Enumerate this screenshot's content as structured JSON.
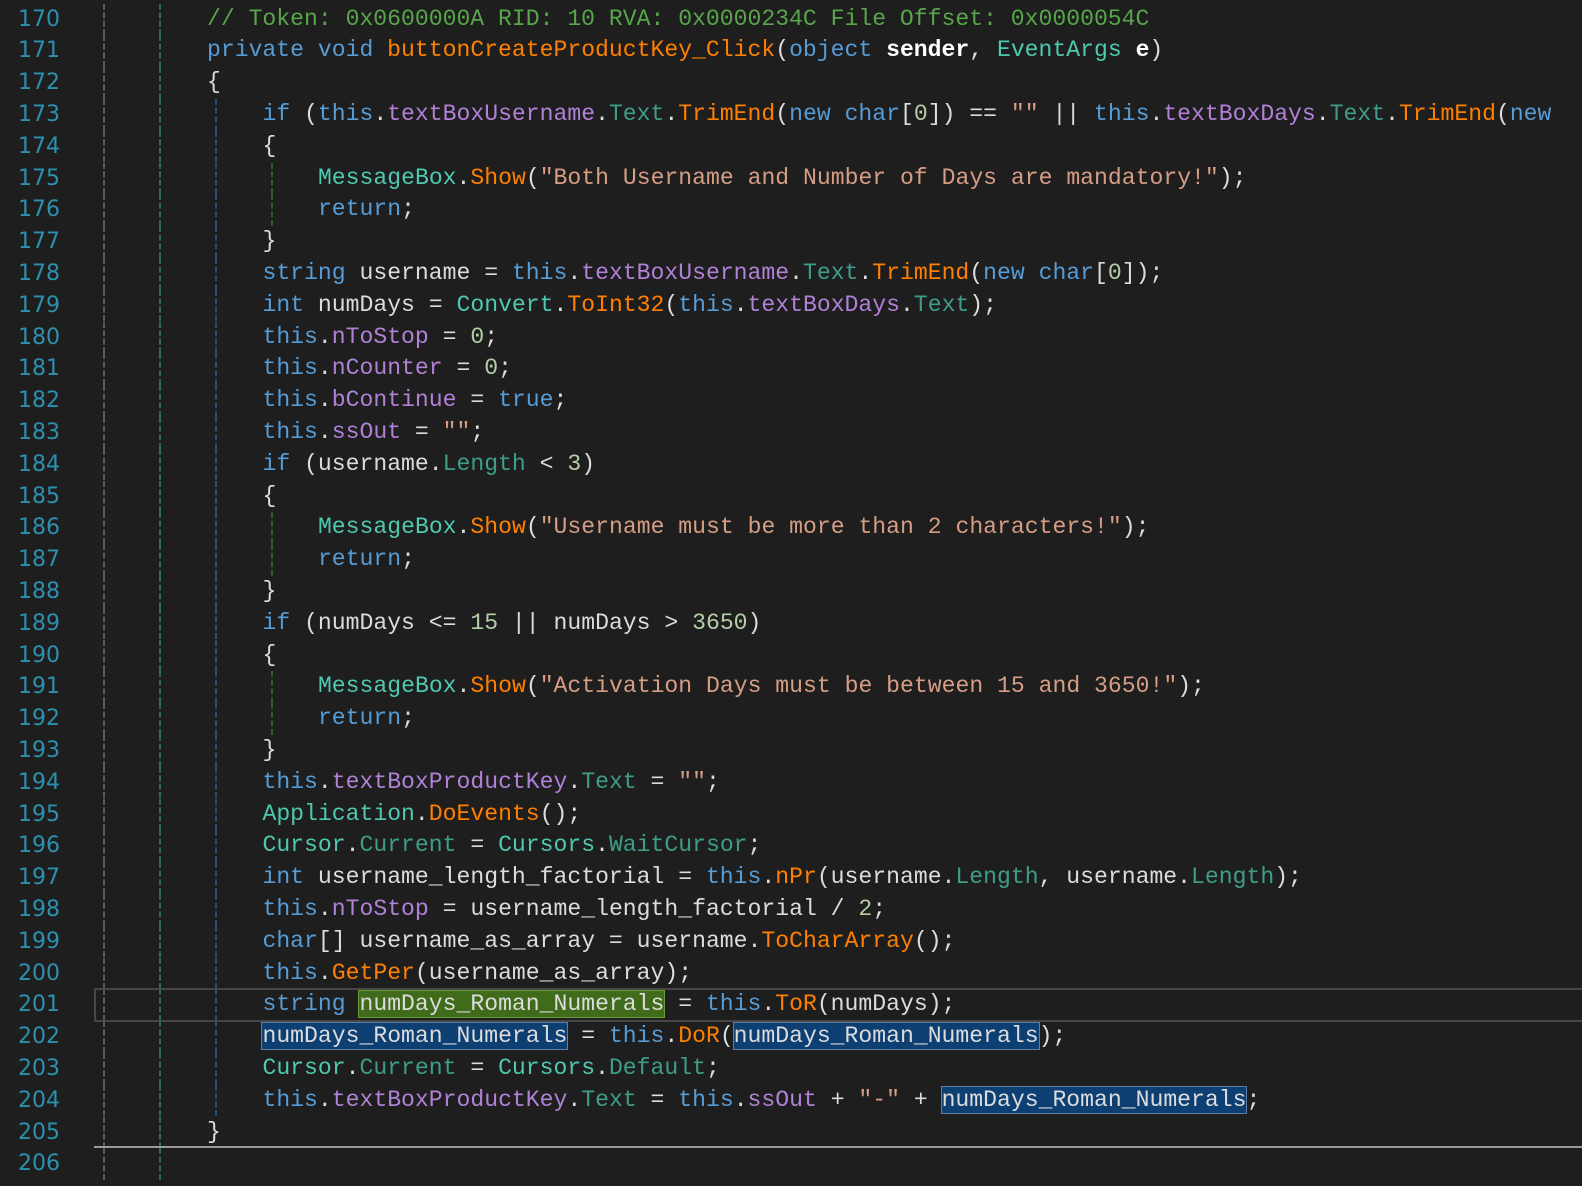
{
  "editor": {
    "first_line_number": 170,
    "current_line": 201,
    "highlighted_symbol": "numDays_Roman_Numerals",
    "colors": {
      "background": "#1e1e1e",
      "line_number": "#2b91af",
      "keyword": "#569cd6",
      "type": "#4ec9b0",
      "method": "#ff8000",
      "field": "#b180d7",
      "string": "#d69d85",
      "number": "#b5cea8",
      "comment": "#57a64a",
      "definition_highlight": "#3f6b1a",
      "reference_highlight": "#0e3f73"
    },
    "lines": [
      {
        "n": "170",
        "indent": 0,
        "tokens": [
          [
            "cmt",
            "// Token: 0x0600000A RID: 10 RVA: 0x0000234C File Offset: 0x0000054C"
          ]
        ]
      },
      {
        "n": "171",
        "indent": 0,
        "tokens": [
          [
            "kw",
            "private"
          ],
          [
            "punc",
            " "
          ],
          [
            "kw",
            "void"
          ],
          [
            "punc",
            " "
          ],
          [
            "method",
            "buttonCreateProductKey_Click"
          ],
          [
            "punc",
            "("
          ],
          [
            "kw",
            "object"
          ],
          [
            "punc",
            " "
          ],
          [
            "param",
            "sender"
          ],
          [
            "punc",
            ", "
          ],
          [
            "type",
            "EventArgs"
          ],
          [
            "punc",
            " "
          ],
          [
            "param",
            "e"
          ],
          [
            "punc",
            ")"
          ]
        ]
      },
      {
        "n": "172",
        "indent": 0,
        "tokens": [
          [
            "punc",
            "{"
          ]
        ]
      },
      {
        "n": "173",
        "indent": 1,
        "tokens": [
          [
            "kw",
            "if"
          ],
          [
            "punc",
            " ("
          ],
          [
            "kw",
            "this"
          ],
          [
            "punc",
            "."
          ],
          [
            "field",
            "textBoxUsername"
          ],
          [
            "punc",
            "."
          ],
          [
            "prop",
            "Text"
          ],
          [
            "punc",
            "."
          ],
          [
            "method",
            "TrimEnd"
          ],
          [
            "punc",
            "("
          ],
          [
            "kw",
            "new"
          ],
          [
            "punc",
            " "
          ],
          [
            "kw",
            "char"
          ],
          [
            "punc",
            "["
          ],
          [
            "num",
            "0"
          ],
          [
            "punc",
            "]) == "
          ],
          [
            "str",
            "\"\""
          ],
          [
            "punc",
            " || "
          ],
          [
            "kw",
            "this"
          ],
          [
            "punc",
            "."
          ],
          [
            "field",
            "textBoxDays"
          ],
          [
            "punc",
            "."
          ],
          [
            "prop",
            "Text"
          ],
          [
            "punc",
            "."
          ],
          [
            "method",
            "TrimEnd"
          ],
          [
            "punc",
            "("
          ],
          [
            "kw",
            "new"
          ]
        ]
      },
      {
        "n": "174",
        "indent": 1,
        "tokens": [
          [
            "punc",
            "{"
          ]
        ]
      },
      {
        "n": "175",
        "indent": 2,
        "tokens": [
          [
            "type",
            "MessageBox"
          ],
          [
            "punc",
            "."
          ],
          [
            "method",
            "Show"
          ],
          [
            "punc",
            "("
          ],
          [
            "str",
            "\"Both Username and Number of Days are mandatory!\""
          ],
          [
            "punc",
            ");"
          ]
        ]
      },
      {
        "n": "176",
        "indent": 2,
        "tokens": [
          [
            "kw",
            "return"
          ],
          [
            "punc",
            ";"
          ]
        ]
      },
      {
        "n": "177",
        "indent": 1,
        "tokens": [
          [
            "punc",
            "}"
          ]
        ]
      },
      {
        "n": "178",
        "indent": 1,
        "tokens": [
          [
            "kw",
            "string"
          ],
          [
            "punc",
            " username = "
          ],
          [
            "kw",
            "this"
          ],
          [
            "punc",
            "."
          ],
          [
            "field",
            "textBoxUsername"
          ],
          [
            "punc",
            "."
          ],
          [
            "prop",
            "Text"
          ],
          [
            "punc",
            "."
          ],
          [
            "method",
            "TrimEnd"
          ],
          [
            "punc",
            "("
          ],
          [
            "kw",
            "new"
          ],
          [
            "punc",
            " "
          ],
          [
            "kw",
            "char"
          ],
          [
            "punc",
            "["
          ],
          [
            "num",
            "0"
          ],
          [
            "punc",
            "]);"
          ]
        ]
      },
      {
        "n": "179",
        "indent": 1,
        "tokens": [
          [
            "kw",
            "int"
          ],
          [
            "punc",
            " numDays = "
          ],
          [
            "type",
            "Convert"
          ],
          [
            "punc",
            "."
          ],
          [
            "method",
            "ToInt32"
          ],
          [
            "punc",
            "("
          ],
          [
            "kw",
            "this"
          ],
          [
            "punc",
            "."
          ],
          [
            "field",
            "textBoxDays"
          ],
          [
            "punc",
            "."
          ],
          [
            "prop",
            "Text"
          ],
          [
            "punc",
            ");"
          ]
        ]
      },
      {
        "n": "180",
        "indent": 1,
        "tokens": [
          [
            "kw",
            "this"
          ],
          [
            "punc",
            "."
          ],
          [
            "field",
            "nToStop"
          ],
          [
            "punc",
            " = "
          ],
          [
            "num",
            "0"
          ],
          [
            "punc",
            ";"
          ]
        ]
      },
      {
        "n": "181",
        "indent": 1,
        "tokens": [
          [
            "kw",
            "this"
          ],
          [
            "punc",
            "."
          ],
          [
            "field",
            "nCounter"
          ],
          [
            "punc",
            " = "
          ],
          [
            "num",
            "0"
          ],
          [
            "punc",
            ";"
          ]
        ]
      },
      {
        "n": "182",
        "indent": 1,
        "tokens": [
          [
            "kw",
            "this"
          ],
          [
            "punc",
            "."
          ],
          [
            "field",
            "bContinue"
          ],
          [
            "punc",
            " = "
          ],
          [
            "kw",
            "true"
          ],
          [
            "punc",
            ";"
          ]
        ]
      },
      {
        "n": "183",
        "indent": 1,
        "tokens": [
          [
            "kw",
            "this"
          ],
          [
            "punc",
            "."
          ],
          [
            "field",
            "ssOut"
          ],
          [
            "punc",
            " = "
          ],
          [
            "str",
            "\"\""
          ],
          [
            "punc",
            ";"
          ]
        ]
      },
      {
        "n": "184",
        "indent": 1,
        "tokens": [
          [
            "kw",
            "if"
          ],
          [
            "punc",
            " (username."
          ],
          [
            "prop",
            "Length"
          ],
          [
            "punc",
            " < "
          ],
          [
            "num",
            "3"
          ],
          [
            "punc",
            ")"
          ]
        ]
      },
      {
        "n": "185",
        "indent": 1,
        "tokens": [
          [
            "punc",
            "{"
          ]
        ]
      },
      {
        "n": "186",
        "indent": 2,
        "tokens": [
          [
            "type",
            "MessageBox"
          ],
          [
            "punc",
            "."
          ],
          [
            "method",
            "Show"
          ],
          [
            "punc",
            "("
          ],
          [
            "str",
            "\"Username must be more than 2 characters!\""
          ],
          [
            "punc",
            ");"
          ]
        ]
      },
      {
        "n": "187",
        "indent": 2,
        "tokens": [
          [
            "kw",
            "return"
          ],
          [
            "punc",
            ";"
          ]
        ]
      },
      {
        "n": "188",
        "indent": 1,
        "tokens": [
          [
            "punc",
            "}"
          ]
        ]
      },
      {
        "n": "189",
        "indent": 1,
        "tokens": [
          [
            "kw",
            "if"
          ],
          [
            "punc",
            " (numDays <= "
          ],
          [
            "num",
            "15"
          ],
          [
            "punc",
            " || numDays > "
          ],
          [
            "num",
            "3650"
          ],
          [
            "punc",
            ")"
          ]
        ]
      },
      {
        "n": "190",
        "indent": 1,
        "tokens": [
          [
            "punc",
            "{"
          ]
        ]
      },
      {
        "n": "191",
        "indent": 2,
        "tokens": [
          [
            "type",
            "MessageBox"
          ],
          [
            "punc",
            "."
          ],
          [
            "method",
            "Show"
          ],
          [
            "punc",
            "("
          ],
          [
            "str",
            "\"Activation Days must be between 15 and 3650!\""
          ],
          [
            "punc",
            ");"
          ]
        ]
      },
      {
        "n": "192",
        "indent": 2,
        "tokens": [
          [
            "kw",
            "return"
          ],
          [
            "punc",
            ";"
          ]
        ]
      },
      {
        "n": "193",
        "indent": 1,
        "tokens": [
          [
            "punc",
            "}"
          ]
        ]
      },
      {
        "n": "194",
        "indent": 1,
        "tokens": [
          [
            "kw",
            "this"
          ],
          [
            "punc",
            "."
          ],
          [
            "field",
            "textBoxProductKey"
          ],
          [
            "punc",
            "."
          ],
          [
            "prop",
            "Text"
          ],
          [
            "punc",
            " = "
          ],
          [
            "str",
            "\"\""
          ],
          [
            "punc",
            ";"
          ]
        ]
      },
      {
        "n": "195",
        "indent": 1,
        "tokens": [
          [
            "type",
            "Application"
          ],
          [
            "punc",
            "."
          ],
          [
            "method",
            "DoEvents"
          ],
          [
            "punc",
            "();"
          ]
        ]
      },
      {
        "n": "196",
        "indent": 1,
        "tokens": [
          [
            "type",
            "Cursor"
          ],
          [
            "punc",
            "."
          ],
          [
            "prop",
            "Current"
          ],
          [
            "punc",
            " = "
          ],
          [
            "type",
            "Cursors"
          ],
          [
            "punc",
            "."
          ],
          [
            "prop",
            "WaitCursor"
          ],
          [
            "punc",
            ";"
          ]
        ]
      },
      {
        "n": "197",
        "indent": 1,
        "tokens": [
          [
            "kw",
            "int"
          ],
          [
            "punc",
            " username_length_factorial = "
          ],
          [
            "kw",
            "this"
          ],
          [
            "punc",
            "."
          ],
          [
            "method",
            "nPr"
          ],
          [
            "punc",
            "(username."
          ],
          [
            "prop",
            "Length"
          ],
          [
            "punc",
            ", username."
          ],
          [
            "prop",
            "Length"
          ],
          [
            "punc",
            ");"
          ]
        ]
      },
      {
        "n": "198",
        "indent": 1,
        "tokens": [
          [
            "kw",
            "this"
          ],
          [
            "punc",
            "."
          ],
          [
            "field",
            "nToStop"
          ],
          [
            "punc",
            " = username_length_factorial / "
          ],
          [
            "num",
            "2"
          ],
          [
            "punc",
            ";"
          ]
        ]
      },
      {
        "n": "199",
        "indent": 1,
        "tokens": [
          [
            "kw",
            "char"
          ],
          [
            "punc",
            "[] username_as_array = username."
          ],
          [
            "method",
            "ToCharArray"
          ],
          [
            "punc",
            "();"
          ]
        ]
      },
      {
        "n": "200",
        "indent": 1,
        "tokens": [
          [
            "kw",
            "this"
          ],
          [
            "punc",
            "."
          ],
          [
            "method",
            "GetPer"
          ],
          [
            "punc",
            "(username_as_array);"
          ]
        ]
      },
      {
        "n": "201",
        "indent": 1,
        "tokens": [
          [
            "kw",
            "string"
          ],
          [
            "punc",
            " "
          ],
          [
            "hl-def",
            "numDays_Roman_Numerals"
          ],
          [
            "punc",
            " = "
          ],
          [
            "kw",
            "this"
          ],
          [
            "punc",
            "."
          ],
          [
            "method",
            "ToR"
          ],
          [
            "punc",
            "(numDays);"
          ]
        ]
      },
      {
        "n": "202",
        "indent": 1,
        "tokens": [
          [
            "hl-ref",
            "numDays_Roman_Numerals"
          ],
          [
            "punc",
            " = "
          ],
          [
            "kw",
            "this"
          ],
          [
            "punc",
            "."
          ],
          [
            "method",
            "DoR"
          ],
          [
            "punc",
            "("
          ],
          [
            "hl-ref",
            "numDays_Roman_Numerals"
          ],
          [
            "punc",
            ");"
          ]
        ]
      },
      {
        "n": "203",
        "indent": 1,
        "tokens": [
          [
            "type",
            "Cursor"
          ],
          [
            "punc",
            "."
          ],
          [
            "prop",
            "Current"
          ],
          [
            "punc",
            " = "
          ],
          [
            "type",
            "Cursors"
          ],
          [
            "punc",
            "."
          ],
          [
            "prop",
            "Default"
          ],
          [
            "punc",
            ";"
          ]
        ]
      },
      {
        "n": "204",
        "indent": 1,
        "tokens": [
          [
            "kw",
            "this"
          ],
          [
            "punc",
            "."
          ],
          [
            "field",
            "textBoxProductKey"
          ],
          [
            "punc",
            "."
          ],
          [
            "prop",
            "Text"
          ],
          [
            "punc",
            " = "
          ],
          [
            "kw",
            "this"
          ],
          [
            "punc",
            "."
          ],
          [
            "field",
            "ssOut"
          ],
          [
            "punc",
            " + "
          ],
          [
            "str",
            "\"-\""
          ],
          [
            "punc",
            " + "
          ],
          [
            "hl-ref",
            "numDays_Roman_Numerals"
          ],
          [
            "punc",
            ";"
          ]
        ]
      },
      {
        "n": "205",
        "indent": 0,
        "tokens": [
          [
            "punc",
            "}"
          ]
        ]
      },
      {
        "n": "206",
        "indent": 0,
        "tokens": []
      }
    ]
  }
}
